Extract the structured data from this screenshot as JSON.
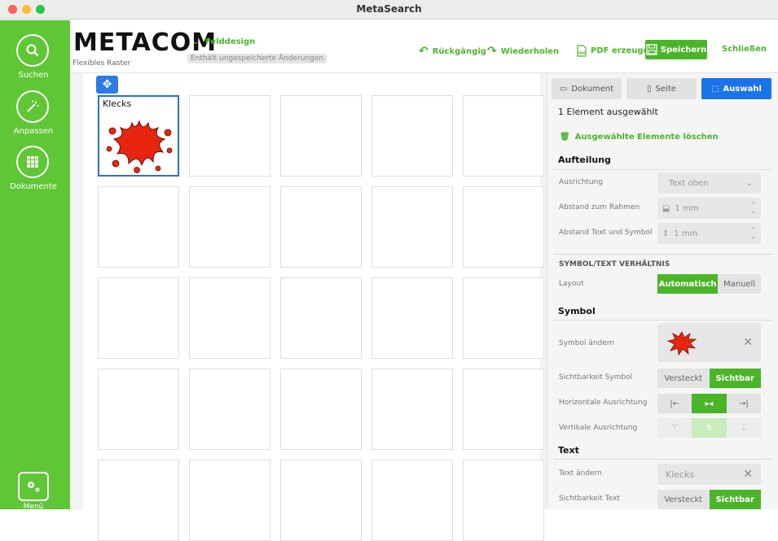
{
  "window": {
    "title": "MetaSearch"
  },
  "sidebar": {
    "items": [
      {
        "label": "Suchen",
        "icon": "search-icon"
      },
      {
        "label": "Anpassen",
        "icon": "magic-wand-icon"
      },
      {
        "label": "Dokumente",
        "icon": "grid-icon"
      }
    ],
    "menu_label": "Menü",
    "menu_icon": "gears-icon"
  },
  "header": {
    "logo": "METACOM",
    "subtitle": "Flexibles Raster",
    "design_selector": "Felddesign",
    "unsaved_note": "Enthält ungespeicherte Änderungen",
    "undo_label": "Rückgängig",
    "redo_label": "Wiederholen",
    "pdf_label": "PDF erzeugen",
    "save_label": "Speichern",
    "close_label": "Schließen"
  },
  "grid": {
    "selected_cell_text": "Klecks",
    "rows": 5,
    "cols": 5
  },
  "panel": {
    "tabs": [
      {
        "label": "Dokument",
        "icon": "document-icon"
      },
      {
        "label": "Seite",
        "icon": "page-icon"
      },
      {
        "label": "Auswahl",
        "icon": "selection-icon"
      }
    ],
    "selection_count": "1 Element ausgewählt",
    "delete_label": "Ausgewählte Elemente löschen",
    "aufteilung": {
      "title": "Aufteilung",
      "ausrichtung_label": "Ausrichtung",
      "ausrichtung_value": "Text oben",
      "abstand_rahmen_label": "Abstand zum Rahmen",
      "abstand_rahmen_value": "1 mm",
      "abstand_text_label": "Abstand Text und Symbol",
      "abstand_text_value": "1 mm"
    },
    "verhaeltnis": {
      "title": "SYMBOL/TEXT VERHÄLTNIS",
      "layout_label": "Layout",
      "auto": "Automatisch",
      "manual": "Manuell"
    },
    "symbol": {
      "title": "Symbol",
      "change_label": "Symbol ändern",
      "visibility_label": "Sichtbarkeit Symbol",
      "hidden": "Versteckt",
      "visible": "Sichtbar",
      "h_align_label": "Horizontale Ausrichtung",
      "v_align_label": "Vertikale Ausrichtung"
    },
    "text": {
      "title": "Text",
      "change_label": "Text ändern",
      "change_value": "Klecks",
      "visibility_label": "Sichtbarkeit Text",
      "hidden": "Versteckt",
      "visible": "Sichtbar"
    }
  },
  "colors": {
    "accent": "#4bb52a",
    "sidebar": "#5fc636",
    "selection": "#2c7be5",
    "splash": "#e8250f"
  }
}
